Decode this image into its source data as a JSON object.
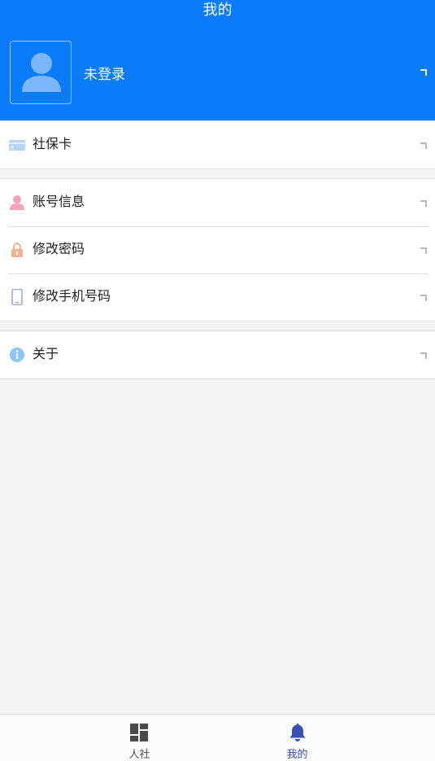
{
  "header": {
    "title": "我的",
    "login_text": "未登录"
  },
  "menu": {
    "group1": [
      {
        "label": "社保卡",
        "icon": "card-icon"
      }
    ],
    "group2": [
      {
        "label": "账号信息",
        "icon": "user-icon"
      },
      {
        "label": "修改密码",
        "icon": "lock-icon"
      },
      {
        "label": "修改手机号码",
        "icon": "phone-icon"
      }
    ],
    "group3": [
      {
        "label": "关于",
        "icon": "info-icon"
      }
    ]
  },
  "tabbar": {
    "tabs": [
      {
        "label": "人社",
        "icon": "grid-icon",
        "active": false
      },
      {
        "label": "我的",
        "icon": "bell-icon",
        "active": true
      }
    ]
  },
  "colors": {
    "primary": "#0a7cfa",
    "active_tab": "#3d4fb3",
    "inactive_tab": "#555555",
    "background": "#f4f4f4"
  }
}
